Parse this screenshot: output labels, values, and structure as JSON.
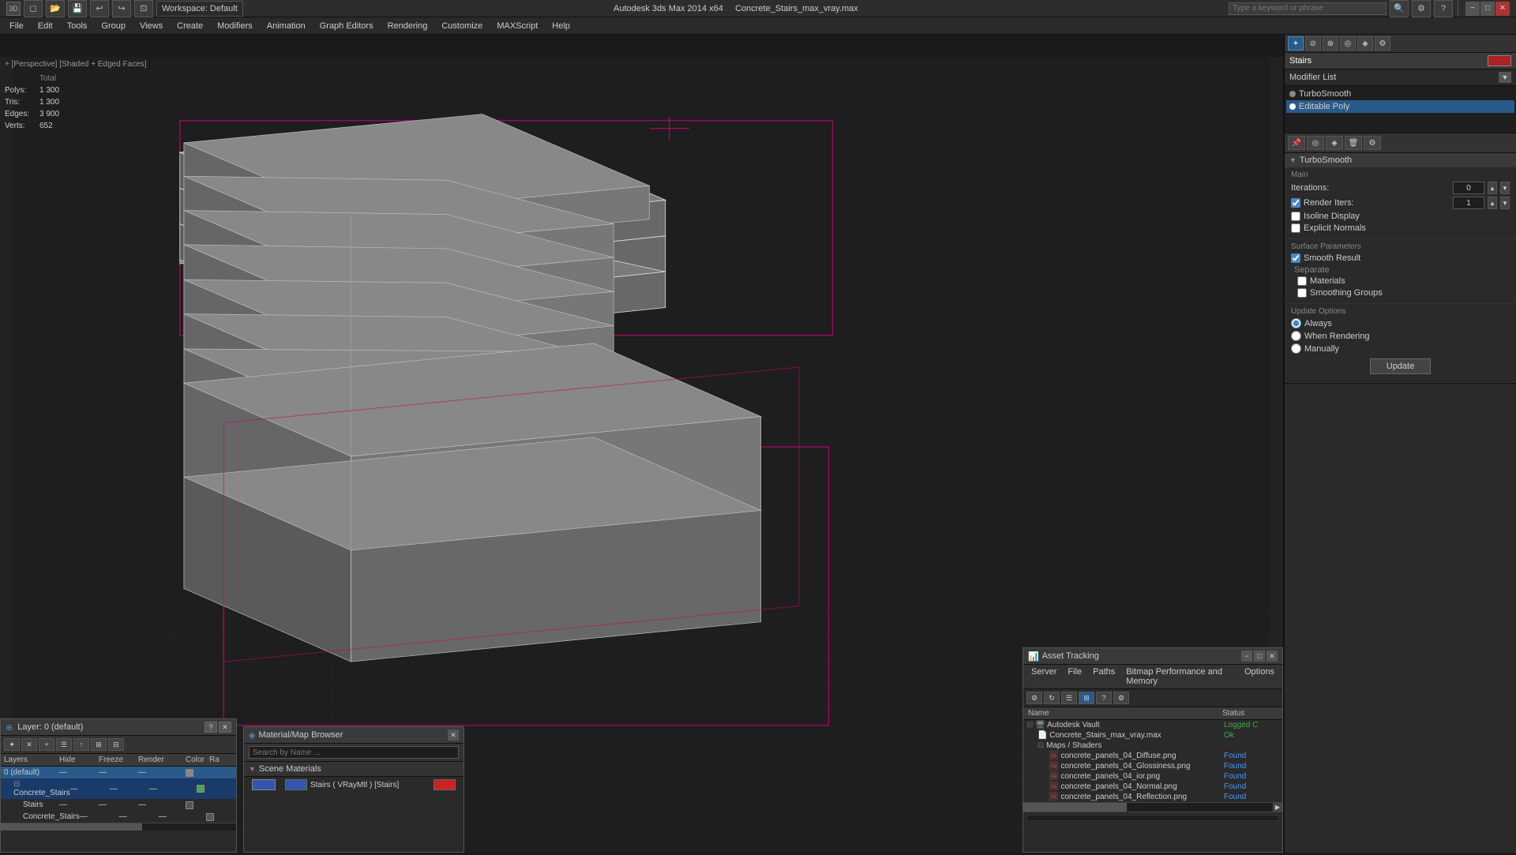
{
  "titlebar": {
    "app_icon": "3ds",
    "workspace_label": "Workspace: Default",
    "title": "Autodesk 3ds Max 2014 x64",
    "filename": "Concrete_Stairs_max_vray.max",
    "search_placeholder": "Type a keyword or phrase"
  },
  "menubar": {
    "items": [
      "File",
      "Edit",
      "Tools",
      "Group",
      "Views",
      "Create",
      "Modifiers",
      "Animation",
      "Graph Editors",
      "Rendering",
      "Customize",
      "MAXScript",
      "Help"
    ]
  },
  "toolbar": {
    "workspace_label": "Workspace: Default"
  },
  "viewport": {
    "label": "+ [Perspective] [Shaded + Edged Faces]",
    "stats": {
      "polys_label": "Polys:",
      "polys_value": "1 300",
      "tris_label": "Tris:",
      "tris_value": "1 300",
      "edges_label": "Edges:",
      "edges_value": "3 900",
      "verts_label": "Verts:",
      "verts_value": "652"
    }
  },
  "right_panel": {
    "object_name": "Stairs",
    "modifier_list_label": "Modifier List",
    "modifiers": [
      {
        "name": "TurboSmooth",
        "active": false
      },
      {
        "name": "Editable Poly",
        "active": true
      }
    ],
    "turbosmooth": {
      "section_title": "TurboSmooth",
      "main_label": "Main",
      "iterations_label": "Iterations:",
      "iterations_value": "0",
      "render_iters_label": "Render Iters:",
      "render_iters_value": "1",
      "isoline_label": "Isoline Display",
      "explicit_normals_label": "Explicit Normals",
      "surface_params_label": "Surface Parameters",
      "smooth_result_label": "Smooth Result",
      "separate_label": "Separate",
      "materials_label": "Materials",
      "smoothing_groups_label": "Smoothing Groups",
      "update_options_label": "Update Options",
      "always_label": "Always",
      "when_rendering_label": "When Rendering",
      "manually_label": "Manually",
      "update_btn": "Update"
    }
  },
  "layer_panel": {
    "title": "Layer: 0 (default)",
    "columns": [
      "Layers",
      "Hide",
      "Freeze",
      "Render",
      "Color",
      "Ra"
    ],
    "items": [
      {
        "name": "0 (default)",
        "indent": 0,
        "hide": "",
        "freeze": "",
        "render": "",
        "color": "gray",
        "active": true
      },
      {
        "name": "Concrete_Stairs",
        "indent": 1,
        "color": "green",
        "selected": true
      },
      {
        "name": "Stairs",
        "indent": 2,
        "color": ""
      },
      {
        "name": "Concrete_Stairs",
        "indent": 2,
        "color": ""
      }
    ]
  },
  "material_browser": {
    "title": "Material/Map Browser",
    "search_placeholder": "Search by Name ...",
    "scene_materials_label": "Scene Materials",
    "items": [
      {
        "name": "Stairs ( VRayMtl ) [Stairs]",
        "type": "VRayMtl",
        "swatch": "red"
      }
    ]
  },
  "asset_tracking": {
    "title": "Asset Tracking",
    "menu_items": [
      "Server",
      "File",
      "Paths",
      "Bitmap Performance and Memory",
      "Options"
    ],
    "columns": [
      "Name",
      "Status"
    ],
    "items": [
      {
        "name": "Autodesk Vault",
        "indent": 0,
        "status": "Logged C",
        "status_class": "status-logged"
      },
      {
        "name": "Concrete_Stairs_max_vray.max",
        "indent": 1,
        "status": "Ok",
        "status_class": "status-ok"
      },
      {
        "name": "Maps / Shaders",
        "indent": 1,
        "status": "",
        "status_class": ""
      },
      {
        "name": "concrete_panels_04_Diffuse.png",
        "indent": 2,
        "status": "Found",
        "status_class": "status-found"
      },
      {
        "name": "concrete_panels_04_Glossiness.png",
        "indent": 2,
        "status": "Found",
        "status_class": "status-found"
      },
      {
        "name": "concrete_panels_04_ior.png",
        "indent": 2,
        "status": "Found",
        "status_class": "status-found"
      },
      {
        "name": "concrete_panels_04_Normal.png",
        "indent": 2,
        "status": "Found",
        "status_class": "status-found"
      },
      {
        "name": "concrete_panels_04_Reflection.png",
        "indent": 2,
        "status": "Found",
        "status_class": "status-found"
      }
    ]
  }
}
